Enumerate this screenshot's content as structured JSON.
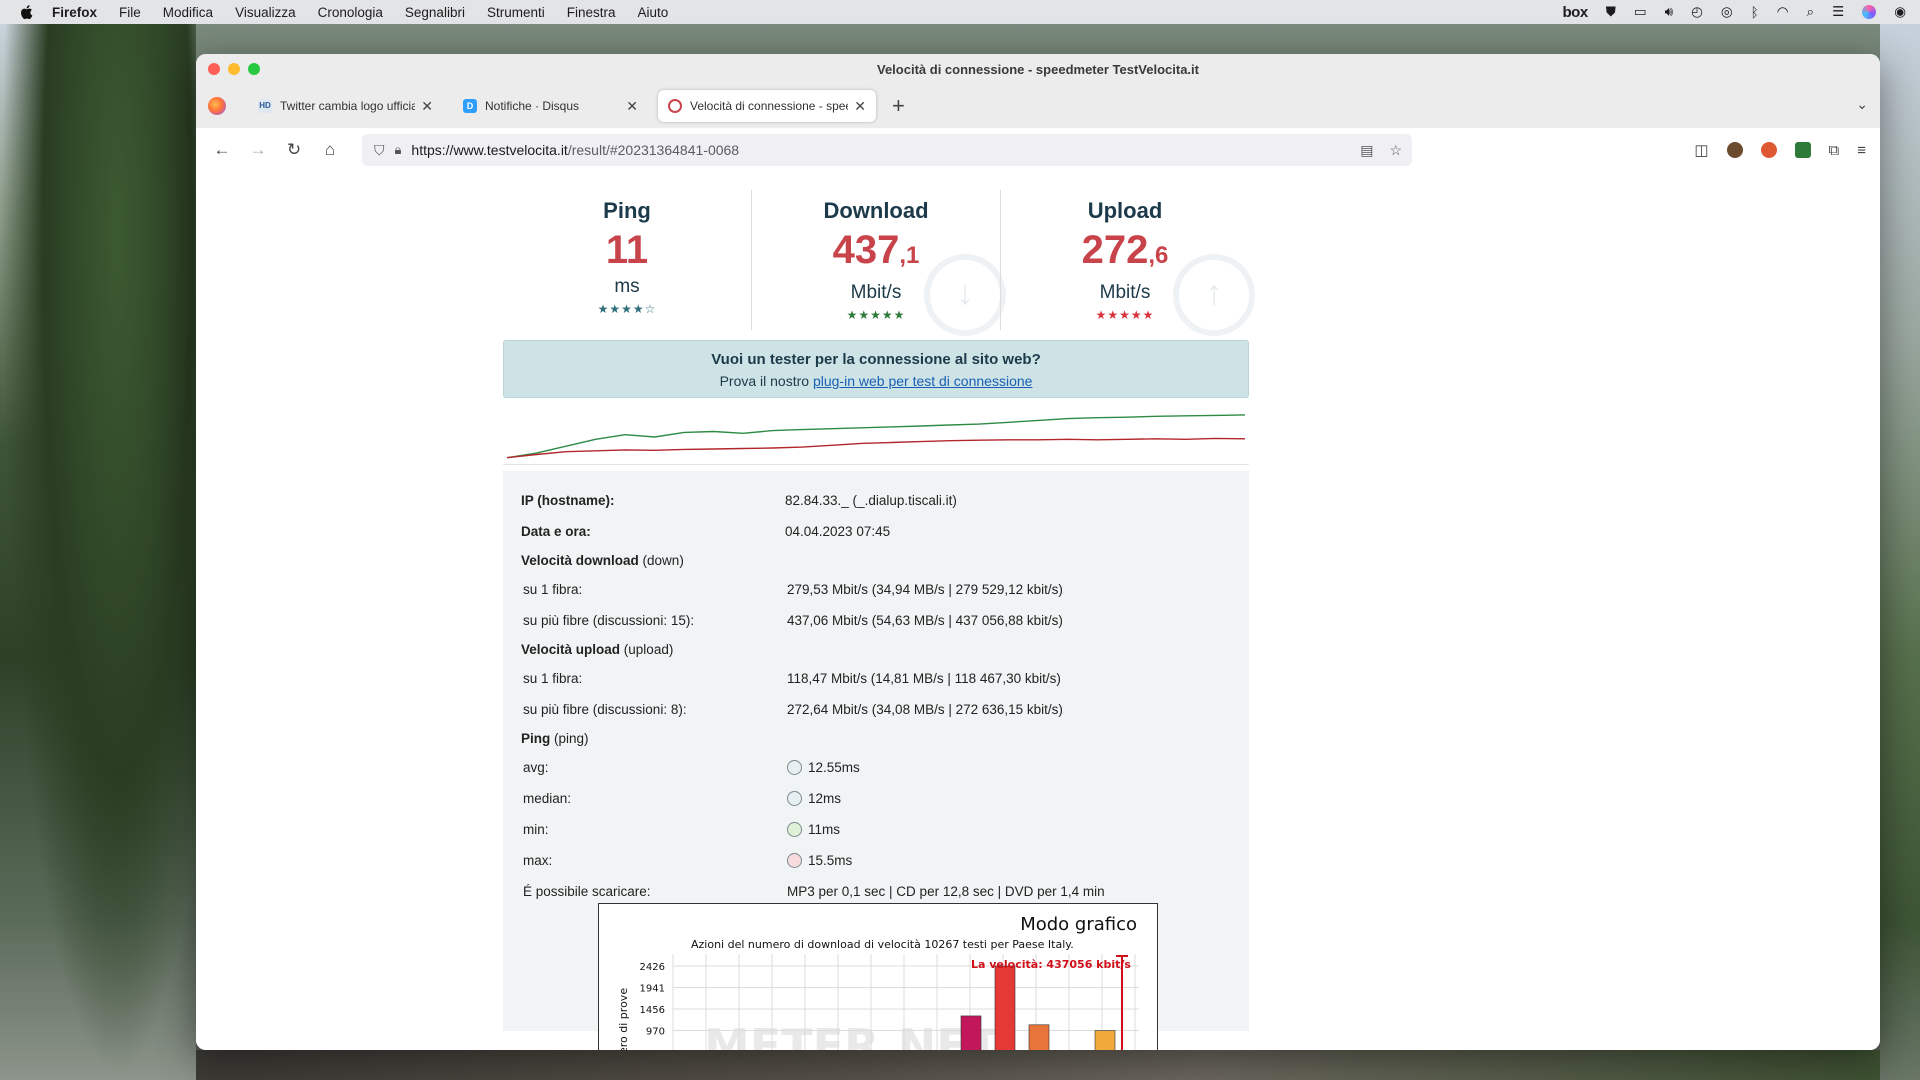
{
  "menubar": {
    "app": "Firefox",
    "items": [
      "File",
      "Modifica",
      "Visualizza",
      "Cronologia",
      "Segnalibri",
      "Strumenti",
      "Finestra",
      "Aiuto"
    ],
    "status_box": "box"
  },
  "window": {
    "title": "Velocità di connessione - speedmeter TestVelocita.it"
  },
  "tabs": [
    {
      "label": "Twitter cambia logo ufficiale e c",
      "icon": "hd-favicon"
    },
    {
      "label": "Notifiche · Disqus",
      "icon": "disqus-favicon"
    },
    {
      "label": "Velocità di connessione - speed",
      "icon": "speedmeter-favicon",
      "active": true
    }
  ],
  "urlbar": {
    "url_host": "https://www.testvelocita.it",
    "url_path": "/result/#20231364841-0068"
  },
  "metrics": {
    "ping": {
      "title": "Ping",
      "value": "11",
      "unit": "ms",
      "stars": "★★★★☆",
      "rating": 4
    },
    "download": {
      "title": "Download",
      "value_int": "437",
      "value_dec": ",1",
      "unit": "Mbit/s",
      "stars": "★★★★★",
      "rating": 5
    },
    "upload": {
      "title": "Upload",
      "value_int": "272",
      "value_dec": ",6",
      "unit": "Mbit/s",
      "stars": "★★★★★",
      "rating": 5
    }
  },
  "promo": {
    "title": "Vuoi un tester per la connessione al sito web?",
    "text": "Prova il nostro",
    "link": "plug-in web per test di connessione"
  },
  "details": {
    "ip_label": "IP (hostname):",
    "ip_value": "82.84.33._ (_.dialup.tiscali.it)",
    "date_label": "Data e ora:",
    "date_value": "04.04.2023 07:45",
    "download_heading": "Velocità download",
    "download_heading_note": "(down)",
    "dl_single_label": "su 1 fibra:",
    "dl_single_value": "279,53 Mbit/s (34,94 MB/s | 279 529,12 kbit/s)",
    "dl_multi_label": "su più fibre (discussioni: 15):",
    "dl_multi_value": "437,06 Mbit/s (54,63 MB/s | 437 056,88 kbit/s)",
    "upload_heading": "Velocità upload",
    "upload_heading_note": "(upload)",
    "ul_single_label": "su 1 fibra:",
    "ul_single_value": "118,47 Mbit/s (14,81 MB/s | 118 467,30 kbit/s)",
    "ul_multi_label": "su più fibre (discussioni: 8):",
    "ul_multi_value": "272,64 Mbit/s (34,08 MB/s | 272 636,15 kbit/s)",
    "ping_heading": "Ping",
    "ping_heading_note": "(ping)",
    "avg_label": "avg:",
    "avg_value": "12.55ms",
    "median_label": "median:",
    "median_value": "12ms",
    "min_label": "min:",
    "min_value": "11ms",
    "max_label": "max:",
    "max_value": "15.5ms",
    "possible_label": "É possibile scaricare:",
    "possible_value": "MP3 per 0,1 sec | CD per 12,8 sec | DVD per 1,4 min"
  },
  "graph": {
    "title": "Modo grafico",
    "subtitle": "Azioni del numero di download di velocità 10267 testi per Paese Italy.",
    "speed_marker": "La velocità: 437056 kbit/s",
    "watermark": "METER.NET"
  },
  "chart_data": {
    "type": "bar",
    "title": "Modo grafico",
    "subtitle": "Azioni del numero di download di velocità 10267 testi per Paese Italy.",
    "ylabel": "ero di prove",
    "yticks": [
      2426,
      1941,
      1456,
      970
    ],
    "visible_bars": [
      {
        "approx_value": 1300,
        "color": "#c2185b"
      },
      {
        "approx_value": 2426,
        "color": "#e53935"
      },
      {
        "approx_value": 1100,
        "color": "#e8743b"
      },
      {
        "approx_value": 970,
        "color": "#f2a93b"
      }
    ],
    "annotation": "La velocità: 437056 kbit/s"
  },
  "sparkline": {
    "download_color": "#2e8b45",
    "upload_color": "#b3262d",
    "download": [
      0.05,
      0.15,
      0.3,
      0.45,
      0.55,
      0.5,
      0.6,
      0.62,
      0.58,
      0.64,
      0.66,
      0.68,
      0.7,
      0.72,
      0.74,
      0.76,
      0.78,
      0.82,
      0.86,
      0.9,
      0.92,
      0.93,
      0.95,
      0.96,
      0.97,
      0.98
    ],
    "upload": [
      0.05,
      0.12,
      0.18,
      0.2,
      0.22,
      0.21,
      0.23,
      0.24,
      0.25,
      0.26,
      0.28,
      0.32,
      0.36,
      0.38,
      0.4,
      0.42,
      0.43,
      0.44,
      0.44,
      0.45,
      0.44,
      0.45,
      0.46,
      0.45,
      0.47,
      0.46
    ]
  },
  "colors": {
    "accent_red": "#c8434a",
    "heading_navy": "#1c3a4a",
    "promo_bg": "#cde3e6"
  }
}
